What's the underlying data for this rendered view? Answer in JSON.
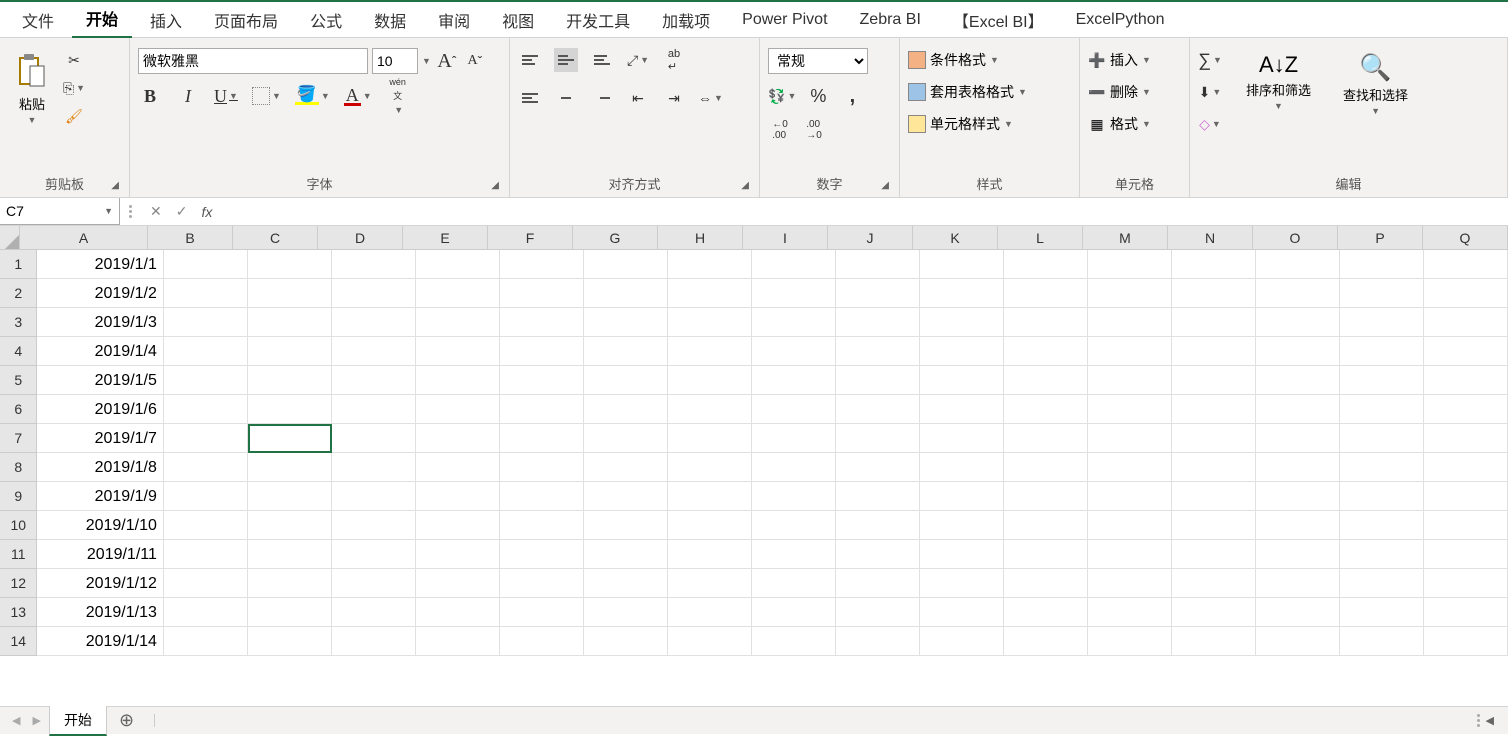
{
  "tabs": {
    "file": "文件",
    "home": "开始",
    "insert": "插入",
    "page_layout": "页面布局",
    "formulas": "公式",
    "data": "数据",
    "review": "审阅",
    "view": "视图",
    "developer": "开发工具",
    "addins": "加载项",
    "powerpivot": "Power Pivot",
    "zebrabi": "Zebra BI",
    "excelbi": "【Excel BI】",
    "excelpython": "ExcelPython"
  },
  "ribbon": {
    "clipboard": {
      "label": "剪贴板",
      "paste": "粘贴"
    },
    "font": {
      "label": "字体",
      "name": "微软雅黑",
      "size": "10",
      "wen": "wén",
      "wen2": "文"
    },
    "align": {
      "label": "对齐方式"
    },
    "number": {
      "label": "数字",
      "format": "常规"
    },
    "styles": {
      "label": "样式",
      "cond": "条件格式",
      "table": "套用表格格式",
      "cell": "单元格样式"
    },
    "cells": {
      "label": "单元格",
      "insert": "插入",
      "delete": "删除",
      "format": "格式"
    },
    "editing": {
      "label": "编辑",
      "sort": "排序和筛选",
      "find": "查找和选择"
    }
  },
  "namebox": "C7",
  "formula": "",
  "columns": [
    "A",
    "B",
    "C",
    "D",
    "E",
    "F",
    "G",
    "H",
    "I",
    "J",
    "K",
    "L",
    "M",
    "N",
    "O",
    "P",
    "Q"
  ],
  "rows": [
    {
      "n": "1",
      "a": "2019/1/1"
    },
    {
      "n": "2",
      "a": "2019/1/2"
    },
    {
      "n": "3",
      "a": "2019/1/3"
    },
    {
      "n": "4",
      "a": "2019/1/4"
    },
    {
      "n": "5",
      "a": "2019/1/5"
    },
    {
      "n": "6",
      "a": "2019/1/6"
    },
    {
      "n": "7",
      "a": "2019/1/7"
    },
    {
      "n": "8",
      "a": "2019/1/8"
    },
    {
      "n": "9",
      "a": "2019/1/9"
    },
    {
      "n": "10",
      "a": "2019/1/10"
    },
    {
      "n": "11",
      "a": "2019/1/11"
    },
    {
      "n": "12",
      "a": "2019/1/12"
    },
    {
      "n": "13",
      "a": "2019/1/13"
    },
    {
      "n": "14",
      "a": "2019/1/14"
    }
  ],
  "active_cell": "C7",
  "sheet": {
    "name": "开始"
  }
}
